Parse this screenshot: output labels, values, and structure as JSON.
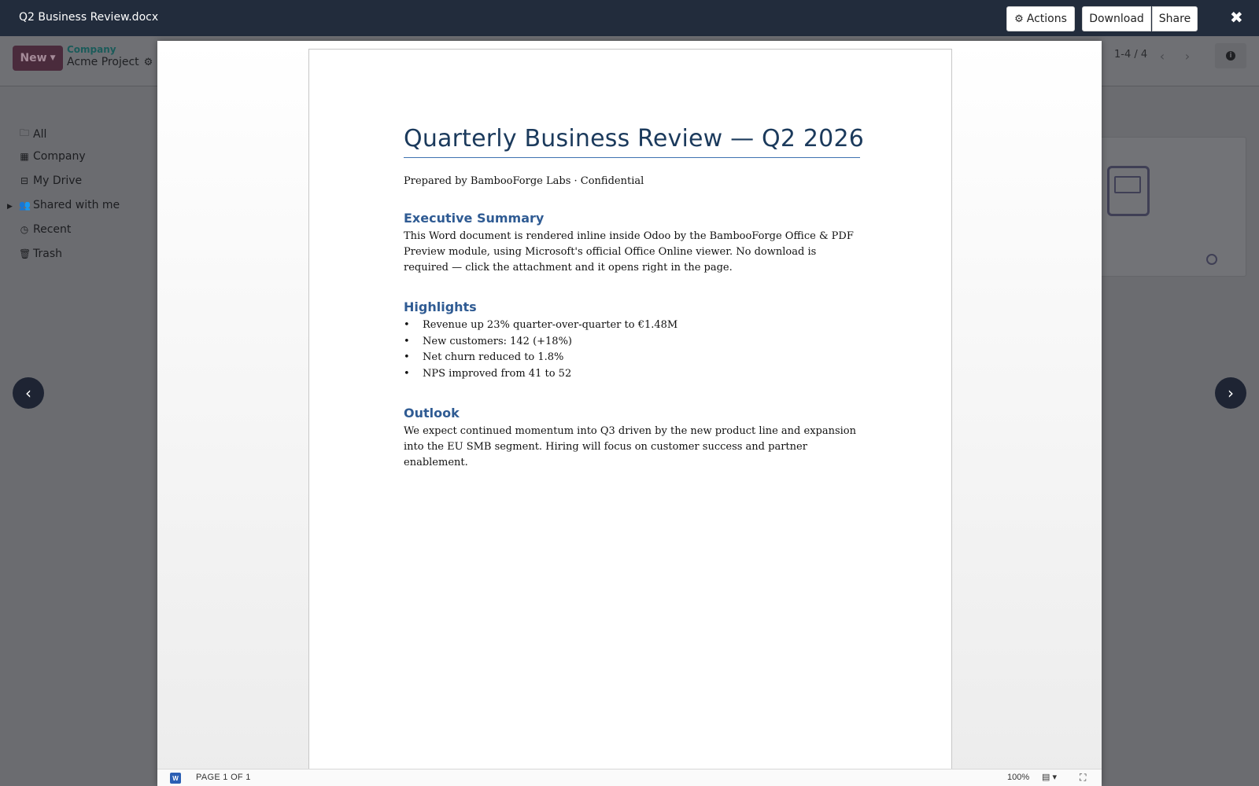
{
  "header": {
    "title": "Q2 Business Review.docx",
    "actions_label": "Actions",
    "download_label": "Download",
    "share_label": "Share",
    "close_symbol": "✖"
  },
  "background": {
    "new_label": "New",
    "breadcrumb_parent": "Company",
    "breadcrumb_current": "Acme Project",
    "pager": "1-4 / 4",
    "sidebar": [
      {
        "label": "All",
        "icon": "folder-icon"
      },
      {
        "label": "Company",
        "icon": "building-icon"
      },
      {
        "label": "My Drive",
        "icon": "hdd-icon"
      },
      {
        "label": "Shared with me",
        "icon": "users-icon"
      },
      {
        "label": "Recent",
        "icon": "clock-icon"
      },
      {
        "label": "Trash",
        "icon": "trash-icon"
      }
    ]
  },
  "document": {
    "title": "Quarterly Business Review — Q2 2026",
    "prepared_by": "Prepared by BambooForge Labs · Confidential",
    "sections": {
      "executive_summary": {
        "heading": "Executive Summary",
        "body": "This Word document is rendered inline inside Odoo by the BambooForge Office & PDF Preview module, using Microsoft's official Office Online viewer. No download is required — click the attachment and it opens right in the page."
      },
      "highlights": {
        "heading": "Highlights",
        "items": [
          "Revenue up 23% quarter-over-quarter to €1.48M",
          "New customers: 142 (+18%)",
          "Net churn reduced to 1.8%",
          "NPS improved from 41 to 52"
        ]
      },
      "outlook": {
        "heading": "Outlook",
        "body": "We expect continued momentum into Q3 driven by the new product line and expansion into the EU SMB segment. Hiring will focus on customer success and partner enablement."
      }
    }
  },
  "statusbar": {
    "app_letter": "W",
    "page_indicator": "PAGE 1 OF 1",
    "zoom": "100%"
  },
  "colors": {
    "header_bg": "#222c3c",
    "title_color": "#1b3a5c",
    "heading_color": "#2f5b93",
    "new_button_bg": "#4a2b3c",
    "nav_arrow_bg": "#1e2433"
  }
}
